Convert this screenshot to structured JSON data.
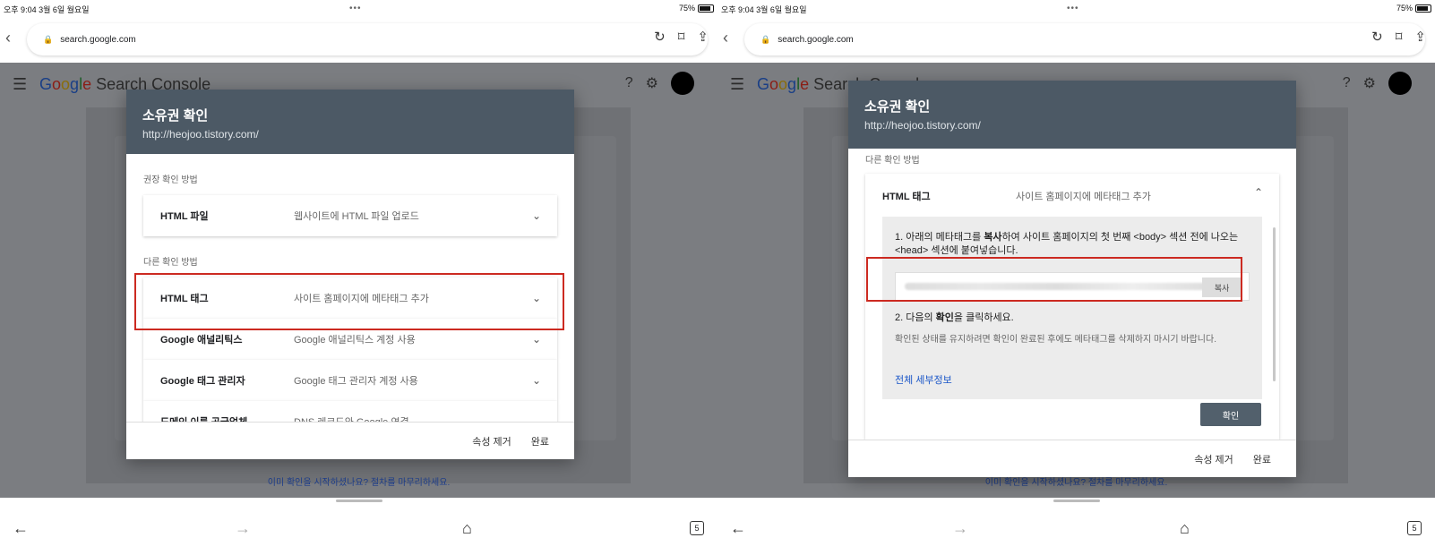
{
  "status": {
    "time_date": "오후 9:04  3월 6일 월요일",
    "battery": "75%",
    "battery_level": 0.75,
    "menu_dots": "•••"
  },
  "browser": {
    "url": "search.google.com",
    "tabs_count": "5"
  },
  "gsc": {
    "app_name_parts": [
      "G",
      "o",
      "o",
      "g",
      "l",
      "e",
      " Search Console"
    ],
    "bottom_link": "이미 확인을 시작하셨나요? 절차를 마무리하세요."
  },
  "dialog": {
    "title": "소유권 확인",
    "url": "http://heojoo.tistory.com/",
    "recommended_label": "권장 확인 방법",
    "other_label": "다른 확인 방법",
    "methods": [
      {
        "name": "HTML 파일",
        "desc": "웹사이트에 HTML 파일 업로드"
      },
      {
        "name": "HTML 태그",
        "desc": "사이트 홈페이지에 메타태그 추가"
      },
      {
        "name": "Google 애널리틱스",
        "desc": "Google 애널리틱스 계정 사용"
      },
      {
        "name": "Google 태그 관리자",
        "desc": "Google 태그 관리자 계정 사용"
      },
      {
        "name": "도메인 이름 공급업체",
        "desc": "DNS 레코드와 Google 연결"
      }
    ],
    "remove_property": "속성 제거",
    "done": "완료"
  },
  "expanded": {
    "step1_pre": "1. 아래의 메타태그를 ",
    "step1_bold": "복사",
    "step1_post": "하여 사이트 홈페이지의 첫 번째 <body> 섹션 전에 나오는 <head> 섹션에 붙여넣습니다.",
    "copy_label": "복사",
    "step2_pre": "2. 다음의 ",
    "step2_bold": "확인",
    "step2_post": "을 클릭하세요.",
    "note": "확인된 상태를 유지하려면 확인이 완료된 후에도 메타태그를 삭제하지 마시기 바랍니다.",
    "details_link": "전체 세부정보",
    "confirm": "확인"
  },
  "colors": {
    "dialog_header": "#4c5965",
    "highlight": "#cc2a21",
    "link": "#1a56c8"
  }
}
